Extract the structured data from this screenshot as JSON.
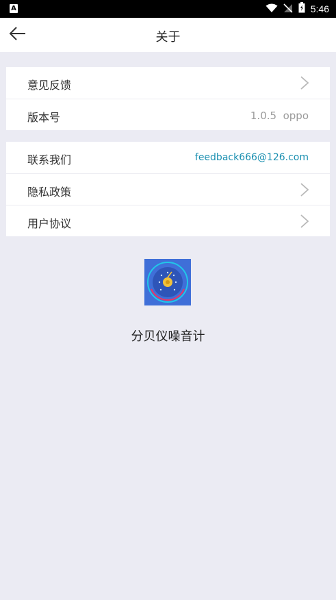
{
  "status_bar": {
    "time": "5:46",
    "left_icon_letter": "A"
  },
  "header": {
    "title": "关于"
  },
  "group1": {
    "rows": [
      {
        "label": "意见反馈"
      },
      {
        "label": "版本号",
        "value": "1.0.5  oppo"
      }
    ]
  },
  "group2": {
    "rows": [
      {
        "label": "联系我们",
        "value": "feedback666@126.com"
      },
      {
        "label": "隐私政策"
      },
      {
        "label": "用户协议"
      }
    ]
  },
  "app": {
    "name": "分贝仪噪音计"
  },
  "colors": {
    "background": "#ebebf3",
    "link": "#1a8fb0",
    "icon_bg": "#3f6fd8"
  }
}
